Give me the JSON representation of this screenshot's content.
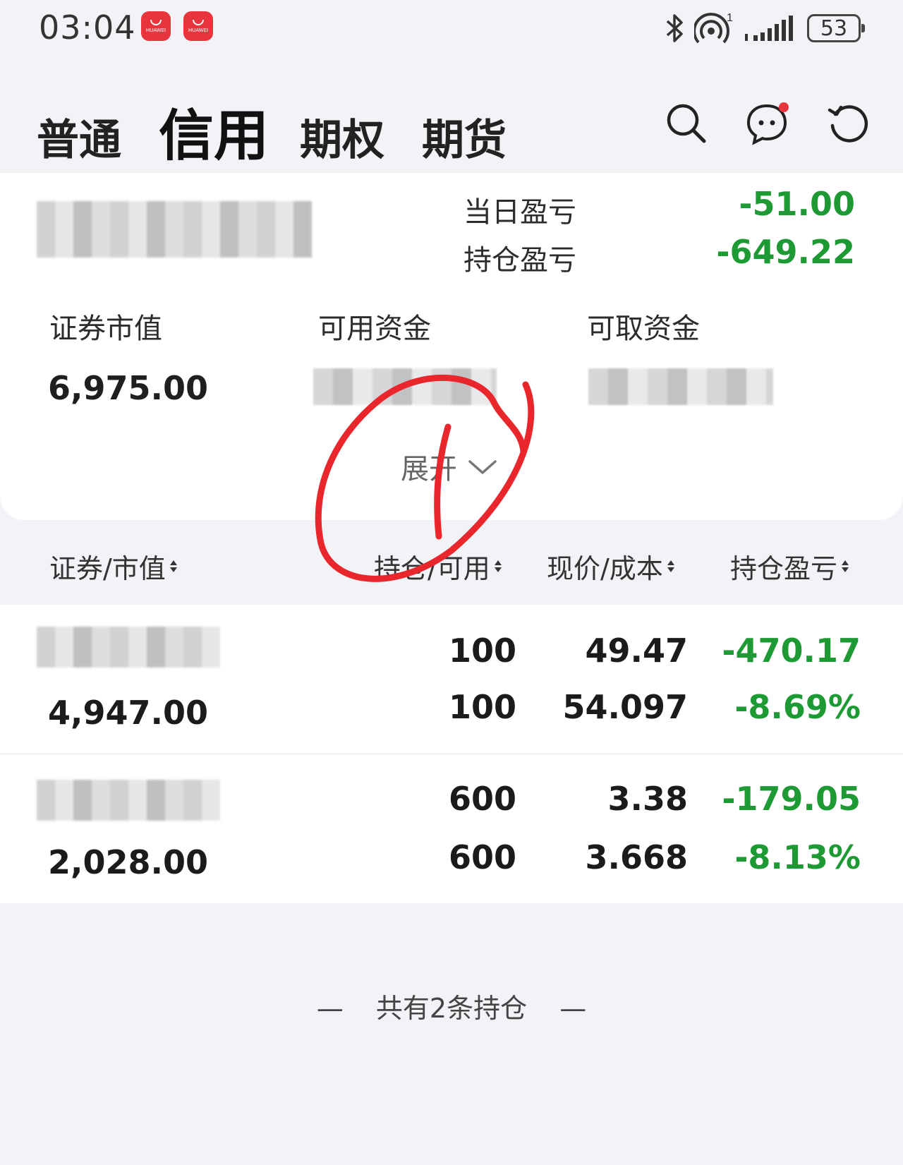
{
  "status_bar": {
    "time": "03:04",
    "app_badge_text": "HUAWEI",
    "battery": "53",
    "signal_prefix": "1"
  },
  "tabs": [
    "普通",
    "信用",
    "期权",
    "期货"
  ],
  "icons": [
    "search-icon",
    "message-icon",
    "refresh-icon"
  ],
  "summary": {
    "daily_pl_label": "当日盈亏",
    "daily_pl_value": "-51.00",
    "position_pl_label": "持仓盈亏",
    "position_pl_value": "-649.22",
    "market_value_label": "证券市值",
    "market_value": "6,975.00",
    "available_funds_label": "可用资金",
    "withdrawable_funds_label": "可取资金",
    "expand_label": "展开"
  },
  "table": {
    "headers": [
      "证券/市值",
      "持仓/可用",
      "现价/成本",
      "持仓盈亏"
    ],
    "rows": [
      {
        "market_value": "4,947.00",
        "position": "100",
        "available": "100",
        "price": "49.47",
        "cost": "54.097",
        "pl": "-470.17",
        "pl_pct": "-8.69%"
      },
      {
        "market_value": "2,028.00",
        "position": "600",
        "available": "600",
        "price": "3.38",
        "cost": "3.668",
        "pl": "-179.05",
        "pl_pct": "-8.13%"
      }
    ]
  },
  "footer": "共有2条持仓",
  "colors": {
    "loss_green": "#1d9a33",
    "annotation_red": "#e8262b",
    "badge_red": "#e8353d"
  }
}
